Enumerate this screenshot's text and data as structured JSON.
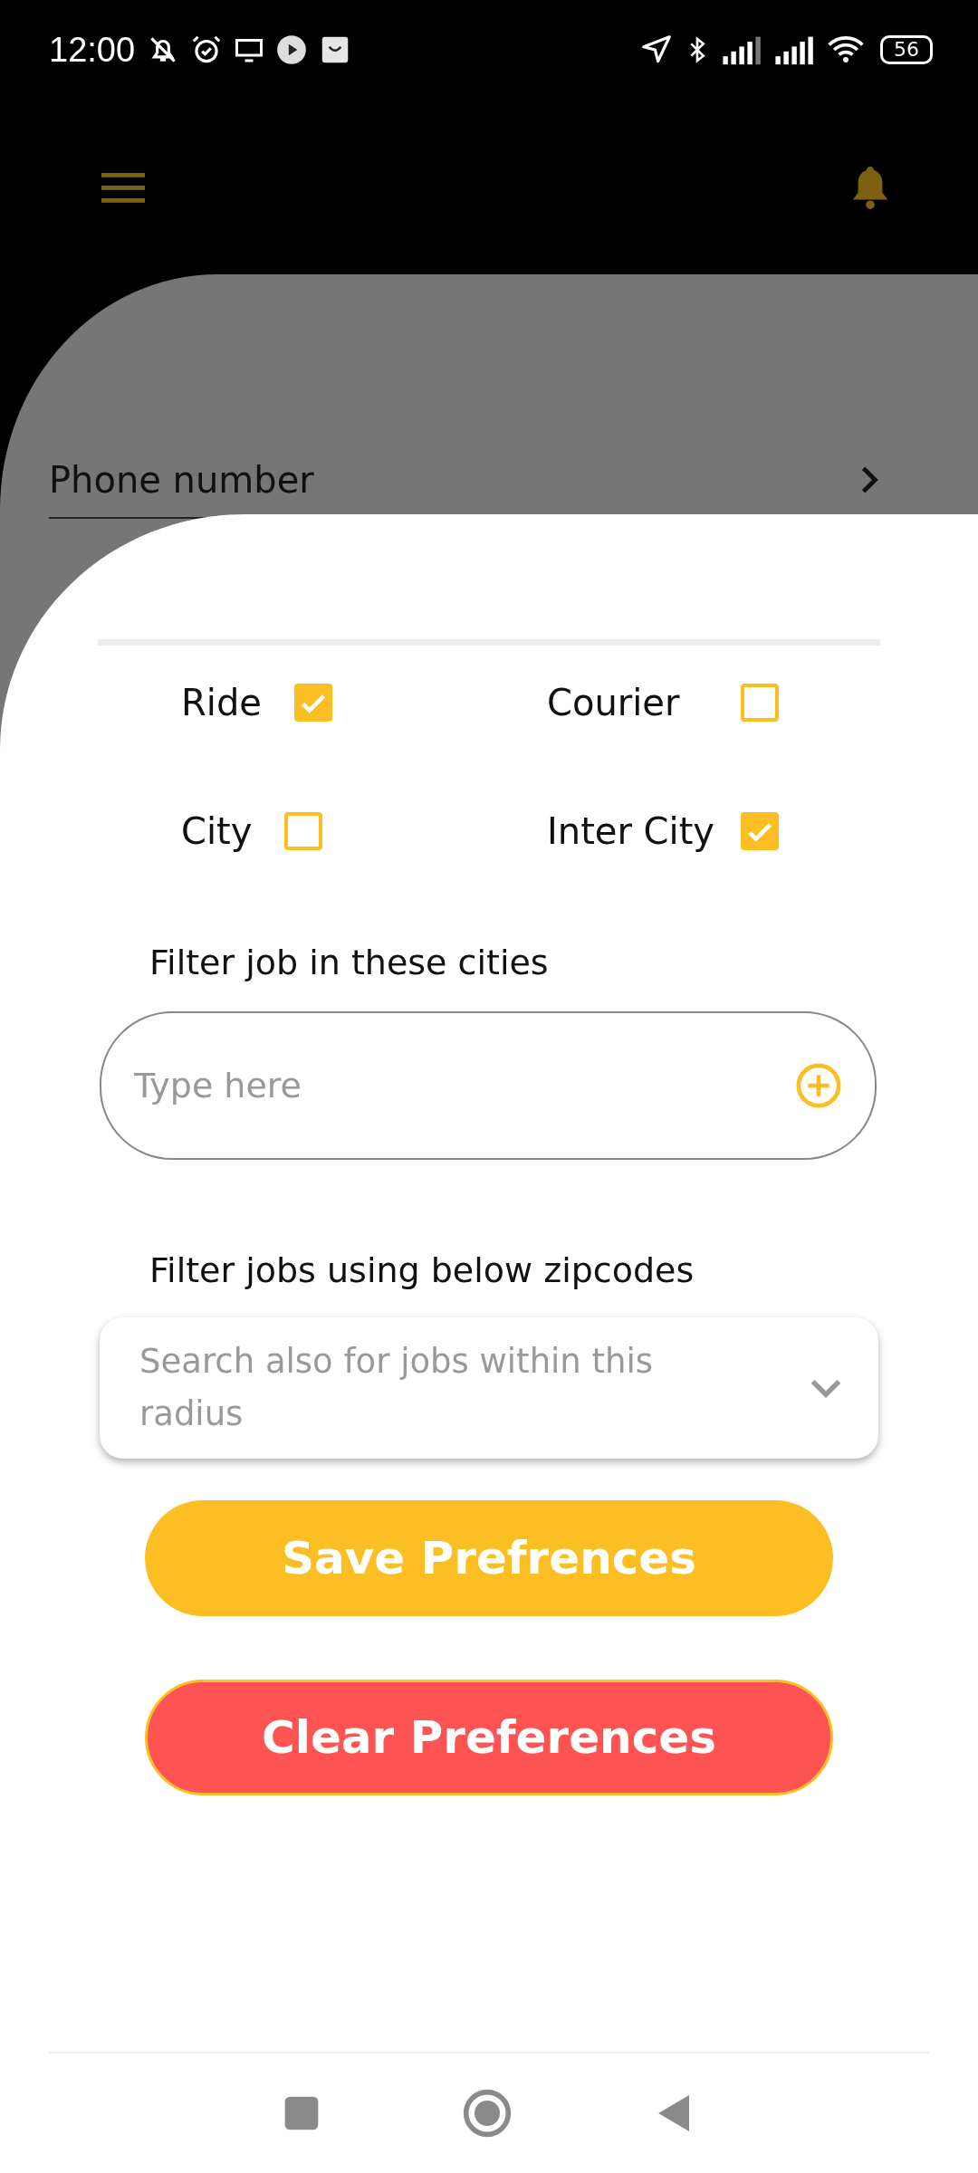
{
  "status_bar": {
    "time": "12:00",
    "battery": "56"
  },
  "background_list": [
    {
      "label": "Phone number"
    }
  ],
  "sheet": {
    "options": [
      {
        "label": "Ride",
        "checked": true
      },
      {
        "label": "Courier",
        "checked": false
      },
      {
        "label": "City",
        "checked": false
      },
      {
        "label": "Inter City",
        "checked": true
      }
    ],
    "city_filter": {
      "label": "Filter job in these cities",
      "placeholder": "Type here"
    },
    "zipcode_filter": {
      "label": "Filter jobs using below zipcodes",
      "placeholder": "Search also for jobs within this radius"
    },
    "buttons": [
      {
        "label": "Save Prefrences",
        "kind": "primary"
      },
      {
        "label": "Clear Preferences",
        "kind": "danger"
      }
    ]
  }
}
